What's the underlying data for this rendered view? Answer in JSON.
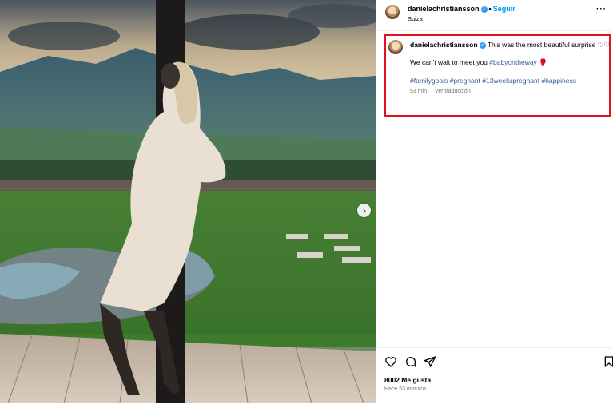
{
  "post": {
    "username": "danielachristiansson",
    "follow_label": "Seguir",
    "location": "Suiza",
    "more_label": "···"
  },
  "caption": {
    "username": "danielachristiansson",
    "text": "This was the most beautiful surprise ♡♡",
    "line2_text": "We can't wait to meet you ",
    "line2_tag": "#babyontheway",
    "line2_emoji": "🥊",
    "hashtags": [
      "#familygoals",
      "#pregnant",
      "#13weekspregnant",
      "#happiness"
    ],
    "age": "53 min",
    "translate_label": "Ver traducción"
  },
  "stats": {
    "likes": "8002 Me gusta",
    "time_ago": "Hace 53 minutos"
  },
  "icons": [
    "heart-icon",
    "comment-icon",
    "share-icon",
    "bookmark-icon",
    "chevron-right-icon",
    "verified-icon"
  ],
  "colors": {
    "accent": "#0095f6",
    "highlight_box": "#e0141e",
    "hashtag": "#3a5a9b",
    "verified": "#3897f0"
  }
}
